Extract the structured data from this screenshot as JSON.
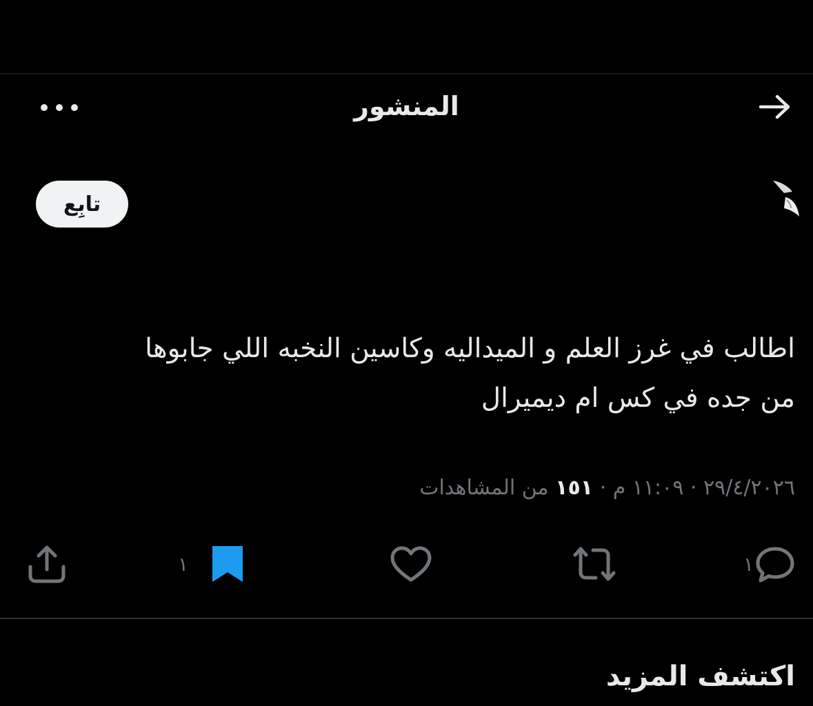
{
  "header": {
    "title": "المنشور"
  },
  "post": {
    "follow_label": "تابِع",
    "body_lines": [
      "اطالب في غرز العلم و الميداليه وكاسين النخبه اللي جابوها",
      "من جده في كس ام ديميرال"
    ],
    "timestamp": "٢٩/٤/٢٠٢٦ · ١١:٠٩ م · ",
    "views_count": "١٥١",
    "views_label": " من المشاهدات"
  },
  "actions": {
    "reply_count": "١",
    "bookmark_count": "١"
  },
  "discover": {
    "title": "اكتشف المزيد"
  },
  "colors": {
    "background": "#000000",
    "text": "#e7e9ea",
    "muted": "#71767b",
    "bookmark_active": "#1d9bf0"
  }
}
